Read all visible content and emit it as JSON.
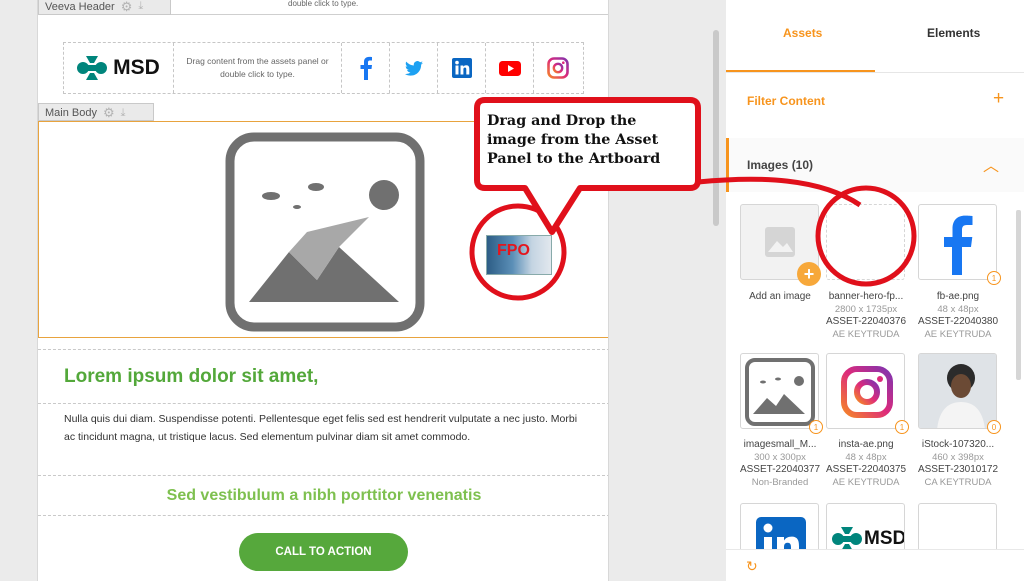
{
  "canvas": {
    "header_tab": "Veeva Header",
    "top_hint": "double click to type.",
    "header": {
      "logo_text": "MSD",
      "hint": "Drag content from the assets panel or double click to type."
    },
    "body_tab": "Main Body",
    "fpo_text": "FPO",
    "headline": "Lorem ipsum dolor sit amet,",
    "body_text": "Nulla quis dui diam. Suspendisse potenti. Pellentesque eget felis sed est hendrerit vulputate a nec justo. Morbi ac tincidunt magna, ut tristique lacus. Sed elementum pulvinar diam sit amet commodo.",
    "subhead": "Sed vestibulum a nibh porttitor venenatis",
    "cta_label": "CALL TO ACTION"
  },
  "callout": {
    "text": "Drag and Drop the image from the Asset Panel to the Artboard"
  },
  "panel": {
    "tabs": [
      "Assets",
      "Elements"
    ],
    "filter_label": "Filter Content",
    "images_label": "Images (10)",
    "assets": [
      {
        "name": "Add an image",
        "size": "",
        "id": "",
        "brand": "",
        "badge": ""
      },
      {
        "name": "banner-hero-fp...",
        "size": "2800 x 1735px",
        "id": "ASSET-22040376",
        "brand": "AE KEYTRUDA",
        "badge": ""
      },
      {
        "name": "fb-ae.png",
        "size": "48 x 48px",
        "id": "ASSET-22040380",
        "brand": "AE KEYTRUDA",
        "badge": "1"
      },
      {
        "name": "imagesmall_M...",
        "size": "300 x 300px",
        "id": "ASSET-22040377",
        "brand": "Non-Branded",
        "badge": "1"
      },
      {
        "name": "insta-ae.png",
        "size": "48 x 48px",
        "id": "ASSET-22040375",
        "brand": "AE KEYTRUDA",
        "badge": "1"
      },
      {
        "name": "iStock-107320...",
        "size": "460 x 398px",
        "id": "ASSET-23010172",
        "brand": "CA KEYTRUDA",
        "badge": "0"
      }
    ],
    "row3_logo": "MSD"
  },
  "colors": {
    "accent": "#f7941d",
    "green": "#53a83a",
    "callout_red": "#e0101b"
  }
}
